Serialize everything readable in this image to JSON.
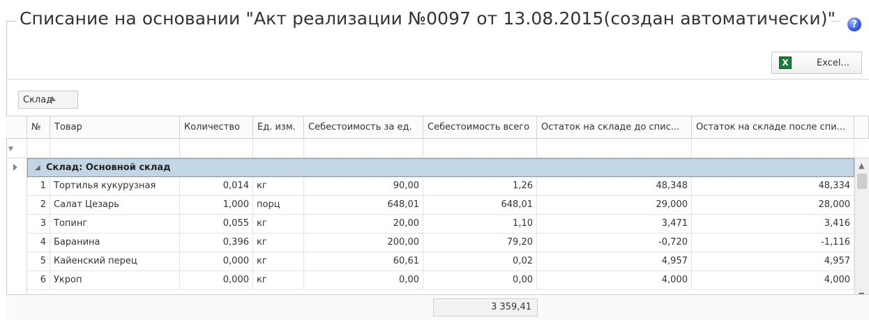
{
  "page": {
    "title": "Списание на основании \"Акт реализации №0097 от 13.08.2015(создан автоматически)\"",
    "help_label": "?"
  },
  "toolbar": {
    "excel_label": "Excel..."
  },
  "grouping": {
    "chip_label": "Склад"
  },
  "table": {
    "columns": [
      "№",
      "Товар",
      "Количество",
      "Ед. изм.",
      "Себестоимость за ед.",
      "Себестоимость всего",
      "Остаток на складе до спис...",
      "Остаток на складе после спи..."
    ],
    "group_label": "Склад: Основной склад",
    "rows": [
      {
        "n": "1",
        "item": "Тортилья кукурузная",
        "qty": "0,014",
        "unit": "кг",
        "unit_cost": "90,00",
        "total_cost": "1,26",
        "before": "48,348",
        "after": "48,334"
      },
      {
        "n": "2",
        "item": "Салат Цезарь",
        "qty": "1,000",
        "unit": "порц",
        "unit_cost": "648,01",
        "total_cost": "648,01",
        "before": "29,000",
        "after": "28,000"
      },
      {
        "n": "3",
        "item": "Топинг",
        "qty": "0,055",
        "unit": "кг",
        "unit_cost": "20,00",
        "total_cost": "1,10",
        "before": "3,471",
        "after": "3,416"
      },
      {
        "n": "4",
        "item": "Баранина",
        "qty": "0,396",
        "unit": "кг",
        "unit_cost": "200,00",
        "total_cost": "79,20",
        "before": "-0,720",
        "after": "-1,116"
      },
      {
        "n": "5",
        "item": "Кайенский перец",
        "qty": "0,000",
        "unit": "кг",
        "unit_cost": "60,61",
        "total_cost": "0,02",
        "before": "4,957",
        "after": "4,957"
      },
      {
        "n": "6",
        "item": "Укроп",
        "qty": "0,000",
        "unit": "кг",
        "unit_cost": "0,00",
        "total_cost": "0,00",
        "before": "4,000",
        "after": "4,000"
      }
    ],
    "total_cost_sum": "3 359,41"
  },
  "colors": {
    "group_row_bg": "#c4d5e6",
    "excel_green": "#1e7a3c",
    "help_blue": "#2c4fd0"
  }
}
